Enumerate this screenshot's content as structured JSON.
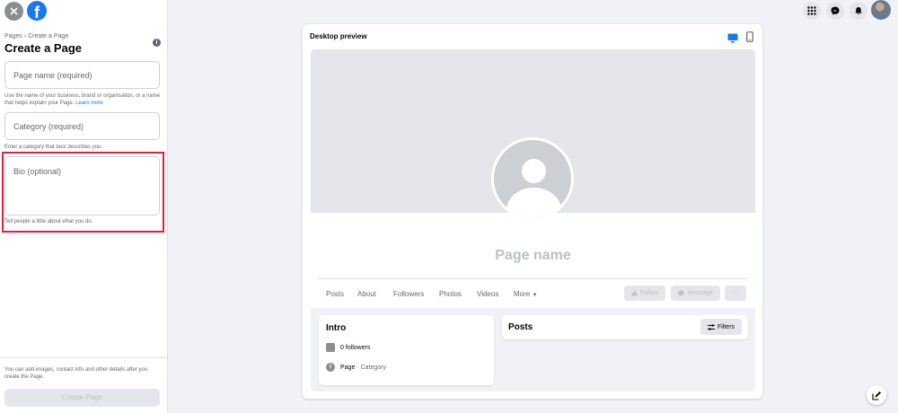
{
  "sidebar": {
    "breadcrumb": "Pages › Create a Page",
    "title": "Create a Page",
    "page_name_placeholder": "Page name (required)",
    "page_name_help": "Use the name of your business, brand or organisation, or a name that helps explain your Page.",
    "learn_more": "Learn more",
    "category_placeholder": "Category (required)",
    "category_help": "Enter a category that best describes you.",
    "bio_placeholder": "Bio (optional)",
    "bio_help": "Tell people a little about what you do.",
    "footer_note": "You can add images, contact info and other details after you create the Page.",
    "create_button": "Create Page"
  },
  "preview": {
    "title": "Desktop preview",
    "page_name": "Page name",
    "tabs": [
      "Posts",
      "About",
      "Followers",
      "Photos",
      "Videos",
      "More"
    ],
    "follow_label": "Follow",
    "message_label": "Message",
    "more_actions_label": "···",
    "intro_title": "Intro",
    "followers_text": "0 followers",
    "page_label": "Page",
    "category_label": "· Category",
    "posts_title": "Posts",
    "filters_label": "Filters"
  },
  "icons": [
    "close-icon",
    "facebook-logo",
    "info-icon",
    "apps-grid-icon",
    "messenger-icon",
    "notifications-icon",
    "desktop-icon",
    "mobile-icon",
    "edit-icon"
  ],
  "colors": {
    "brand": "#1877f2",
    "highlight": "#e41e3f"
  }
}
